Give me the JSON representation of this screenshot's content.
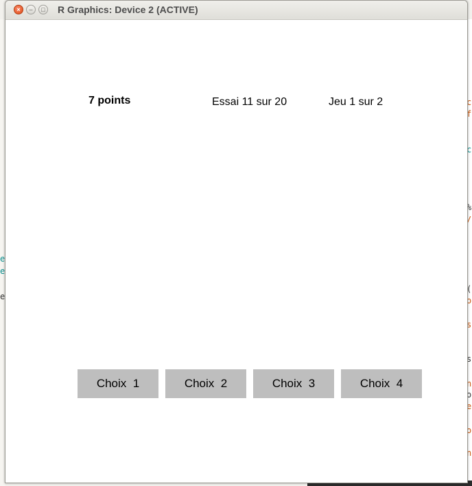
{
  "window": {
    "title": "R Graphics: Device 2 (ACTIVE)",
    "close_glyph": "×",
    "minimize_glyph": "–",
    "maximize_glyph": "□"
  },
  "game": {
    "score_label": "7 points",
    "trial_label": "Essai 11 sur 20",
    "game_label": "Jeu 1 sur 2"
  },
  "choices": [
    {
      "label": "Choix  1"
    },
    {
      "label": "Choix  2"
    },
    {
      "label": "Choix  3"
    },
    {
      "label": "Choix  4"
    }
  ],
  "background": {
    "left_fragments": [
      "e",
      "e",
      "e"
    ],
    "right_fragments": [
      "c",
      "f",
      "c",
      "%",
      "/",
      "(",
      "o",
      "s",
      "s",
      "n",
      "o",
      "e",
      "o",
      "n"
    ]
  },
  "colors": {
    "button_fill": "#bebebe",
    "close_button": "#df4b16",
    "title_text": "#4c4c4c",
    "teal_code": "#0a8e8e",
    "orange_code": "#c8560c"
  }
}
